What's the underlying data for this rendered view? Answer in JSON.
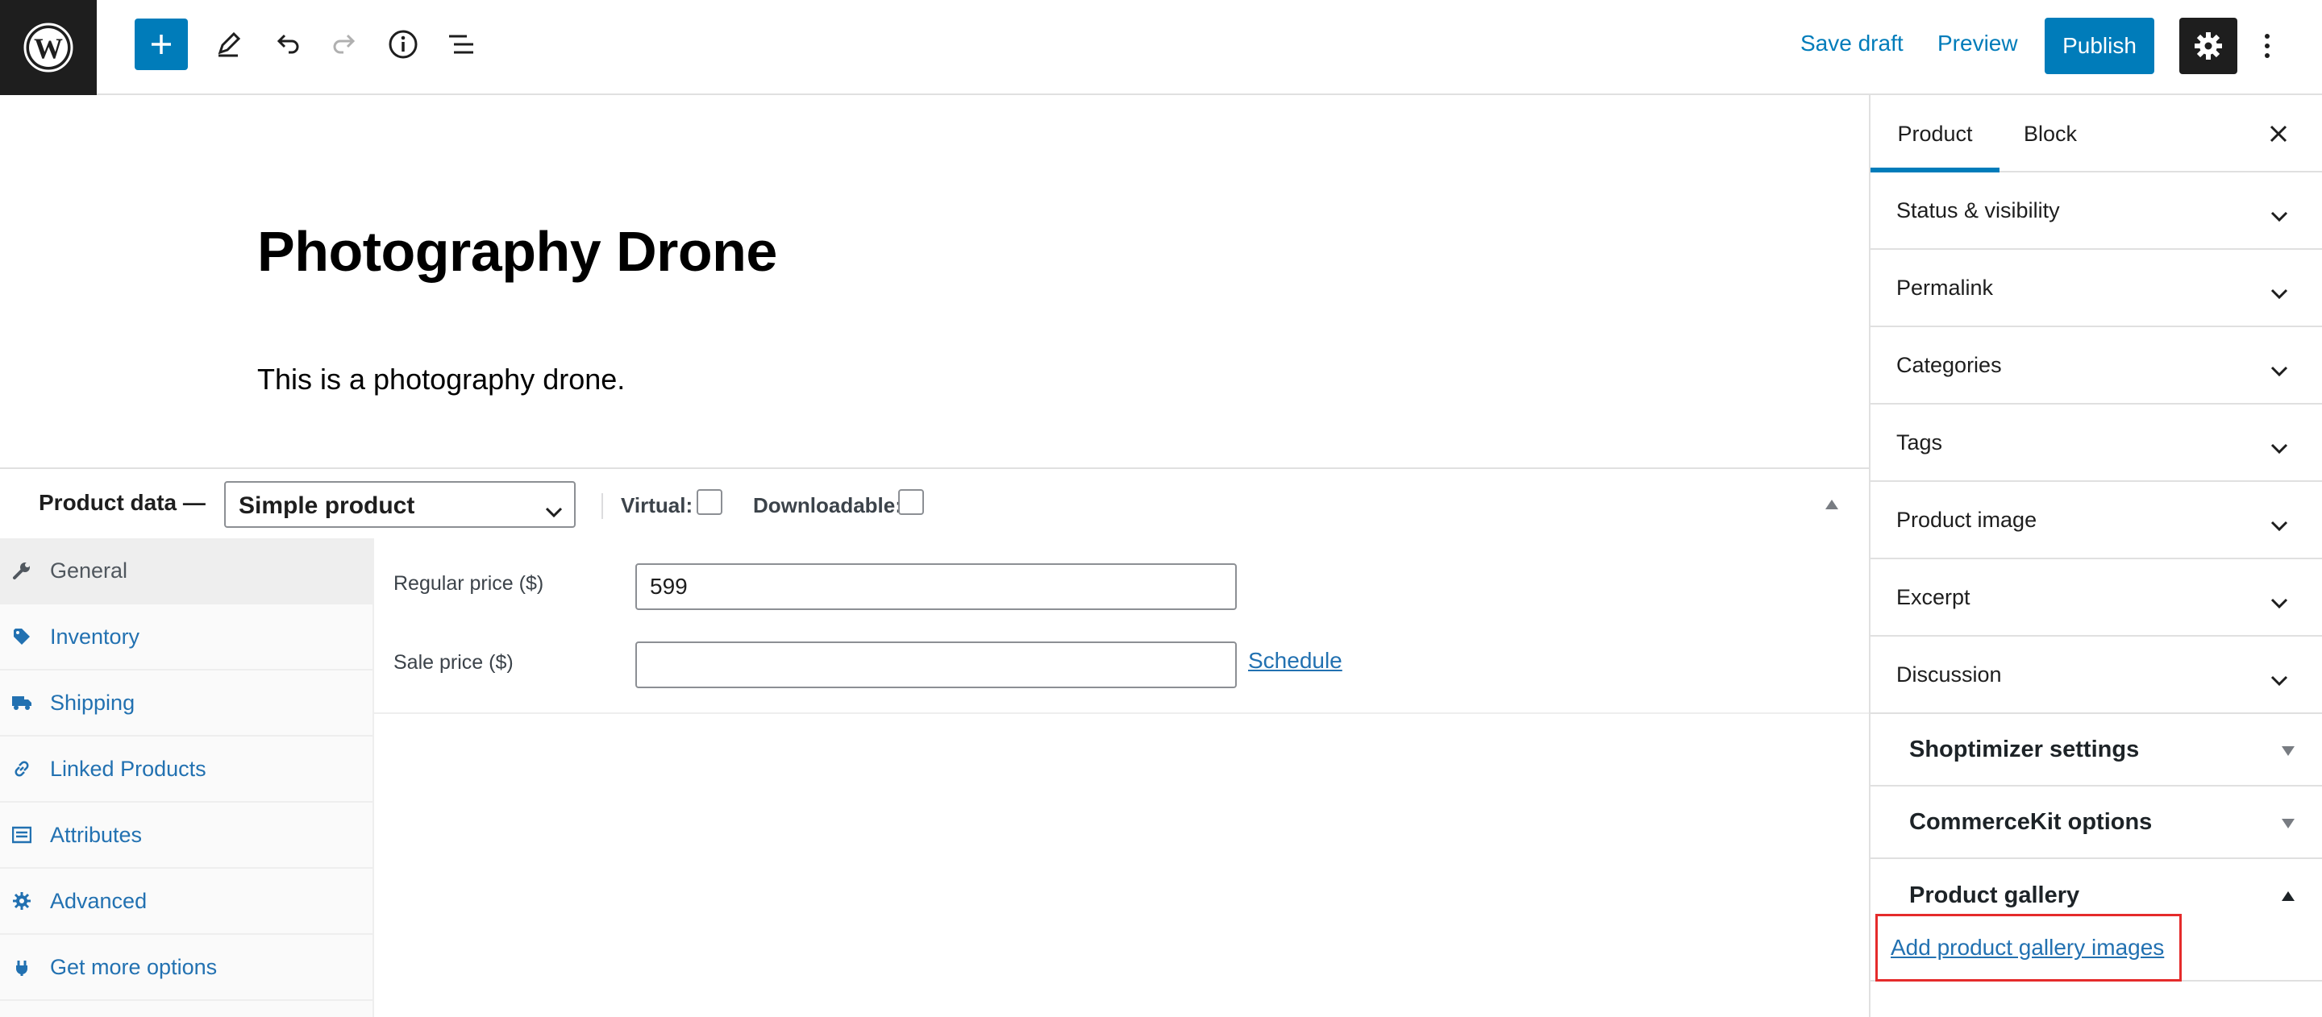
{
  "toolbar": {
    "save_draft_label": "Save draft",
    "preview_label": "Preview",
    "publish_label": "Publish"
  },
  "post": {
    "title": "Photography Drone",
    "paragraph": "This is a photography drone."
  },
  "product_data": {
    "label": "Product data —",
    "type_value": "Simple product",
    "virtual_label": "Virtual:",
    "downloadable_label": "Downloadable:",
    "tabs": [
      {
        "label": "General",
        "icon": "wrench-icon"
      },
      {
        "label": "Inventory",
        "icon": "tag-icon"
      },
      {
        "label": "Shipping",
        "icon": "truck-icon"
      },
      {
        "label": "Linked Products",
        "icon": "link-icon"
      },
      {
        "label": "Attributes",
        "icon": "list-icon"
      },
      {
        "label": "Advanced",
        "icon": "gear-icon"
      },
      {
        "label": "Get more options",
        "icon": "plugin-icon"
      }
    ],
    "general": {
      "regular_price_label": "Regular price ($)",
      "regular_price_value": "599",
      "sale_price_label": "Sale price ($)",
      "sale_price_value": "",
      "schedule_label": "Schedule"
    }
  },
  "sidebar": {
    "tabs": [
      "Product",
      "Block"
    ],
    "panels": [
      "Status & visibility",
      "Permalink",
      "Categories",
      "Tags",
      "Product image",
      "Excerpt",
      "Discussion"
    ],
    "metaboxes": [
      "Shoptimizer settings",
      "CommerceKit options",
      "Product gallery"
    ],
    "gallery_link": "Add product gallery images"
  },
  "colors": {
    "accent": "#007cba",
    "link": "#2271b1",
    "dark": "#1e1e1e",
    "highlight_box": "#e52b2b"
  }
}
